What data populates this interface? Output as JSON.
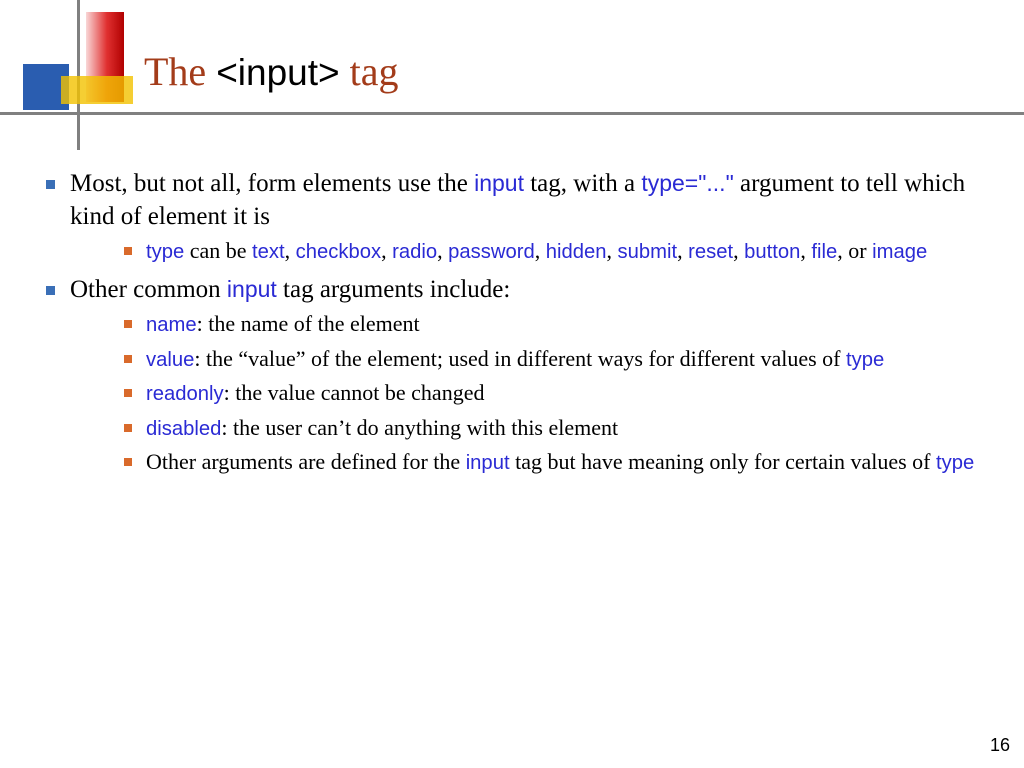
{
  "title": {
    "pre": "The ",
    "code": "<input>",
    "post": " tag"
  },
  "b1": {
    "t1": "Most, but not all, form elements use the ",
    "kw1": "input",
    "t2": " tag, with a ",
    "kw2": "type=\"...\"",
    "t3": " argument to tell which kind of element it is"
  },
  "b1s1": {
    "kw1": "type",
    "t1": " can be ",
    "kw2": "text",
    "c": ", ",
    "kw3": "checkbox",
    "kw4": "radio",
    "kw5": "password",
    "kw6": "hidden",
    "kw7": "submit",
    "kw8": "reset",
    "kw9": "button",
    "kw10": "file",
    "t2": ", or ",
    "kw11": "image"
  },
  "b2": {
    "t1": "Other common ",
    "kw1": "input",
    "t2": " tag arguments include:"
  },
  "b2s1": {
    "kw": "name",
    "t": ": the name of the element"
  },
  "b2s2": {
    "kw": "value",
    "t": ": the “value” of the element; used in different ways for different values of ",
    "kw2": "type"
  },
  "b2s3": {
    "kw": "readonly",
    "t": ": the value cannot be changed"
  },
  "b2s4": {
    "kw": "disabled",
    "t": ": the user can’t do anything with this element"
  },
  "b2s5": {
    "t1": "Other arguments are defined for the ",
    "kw1": "input",
    "t2": " tag but have meaning only for certain values of ",
    "kw2": "type"
  },
  "page_number": "16"
}
